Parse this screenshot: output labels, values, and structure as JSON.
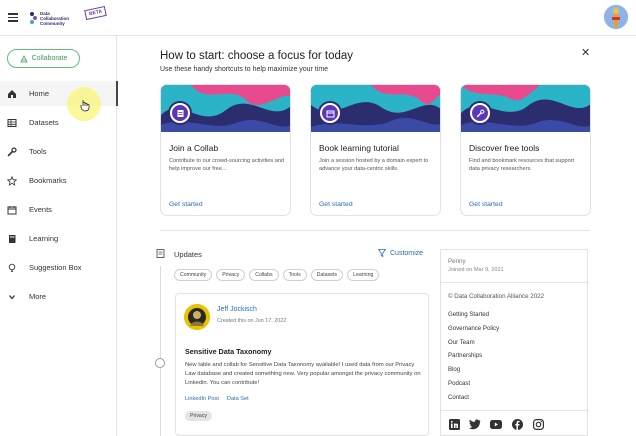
{
  "header": {
    "logo_lines": [
      "Data",
      "Collaboration",
      "Community"
    ],
    "beta": "BETA"
  },
  "sidebar": {
    "collaborate": "Collaborate",
    "items": [
      {
        "label": "Home",
        "icon": "home-icon"
      },
      {
        "label": "Datasets",
        "icon": "table-icon"
      },
      {
        "label": "Tools",
        "icon": "wrench-icon"
      },
      {
        "label": "Bookmarks",
        "icon": "star-icon"
      },
      {
        "label": "Events",
        "icon": "calendar-icon"
      },
      {
        "label": "Learning",
        "icon": "book-icon"
      },
      {
        "label": "Suggestion Box",
        "icon": "lightbulb-icon"
      },
      {
        "label": "More",
        "icon": "chevron-down-icon"
      }
    ],
    "active": "Home"
  },
  "main": {
    "heading": "How to start: choose a focus for today",
    "subheading": "Use these handy shortcuts to help maximize your time",
    "cards": [
      {
        "title": "Join a Collab",
        "desc": "Contribute to our crowd-sourcing activities and help improve our free...",
        "link": "Get started",
        "icon": "clipboard-icon"
      },
      {
        "title": "Book learning tutorial",
        "desc": "Join a session hosted by a domain expert to advance your data-centric skills.",
        "link": "Get started",
        "icon": "calendar-icon"
      },
      {
        "title": "Discover free tools",
        "desc": "Find and bookmark resources that support data privacy researchers.",
        "link": "Get started",
        "icon": "wrench-icon"
      }
    ]
  },
  "updates": {
    "title": "Updates",
    "customize": "Customize",
    "chips": [
      "Community",
      "Privacy",
      "Collabs",
      "Tools",
      "Datasets",
      "Learning"
    ]
  },
  "post": {
    "author": "Jeff Jockisch",
    "date": "Created this on Jun 17, 2022",
    "title": "Sensitive Data Taxonomy",
    "body": "New table and collab for Sensitive Data Taxonomy available! I used data from our Privacy Law database and created something new. Very popular amongst the privacy community on Linkedin. You can contribute!",
    "links": [
      "LinkedIn Post",
      "Data Set"
    ],
    "tag": "Privacy"
  },
  "right_panel": {
    "name": "Penny",
    "joined": "Joined on Mar 9, 2021",
    "copyright": "© Data Collaboration Alliance 2022",
    "links": [
      "Getting Started",
      "Governance Policy",
      "Our Team",
      "Partnerships",
      "Blog",
      "Podcast",
      "Contact"
    ],
    "social": [
      "linkedin-icon",
      "twitter-icon",
      "youtube-icon",
      "facebook-icon",
      "instagram-icon"
    ]
  },
  "colors": {
    "accent": "#2a6db5",
    "collab_green": "#3a9d58",
    "banner_dark": "#2b2d6e",
    "banner_teal": "#2bb3c7",
    "banner_pink": "#e84a8e"
  }
}
